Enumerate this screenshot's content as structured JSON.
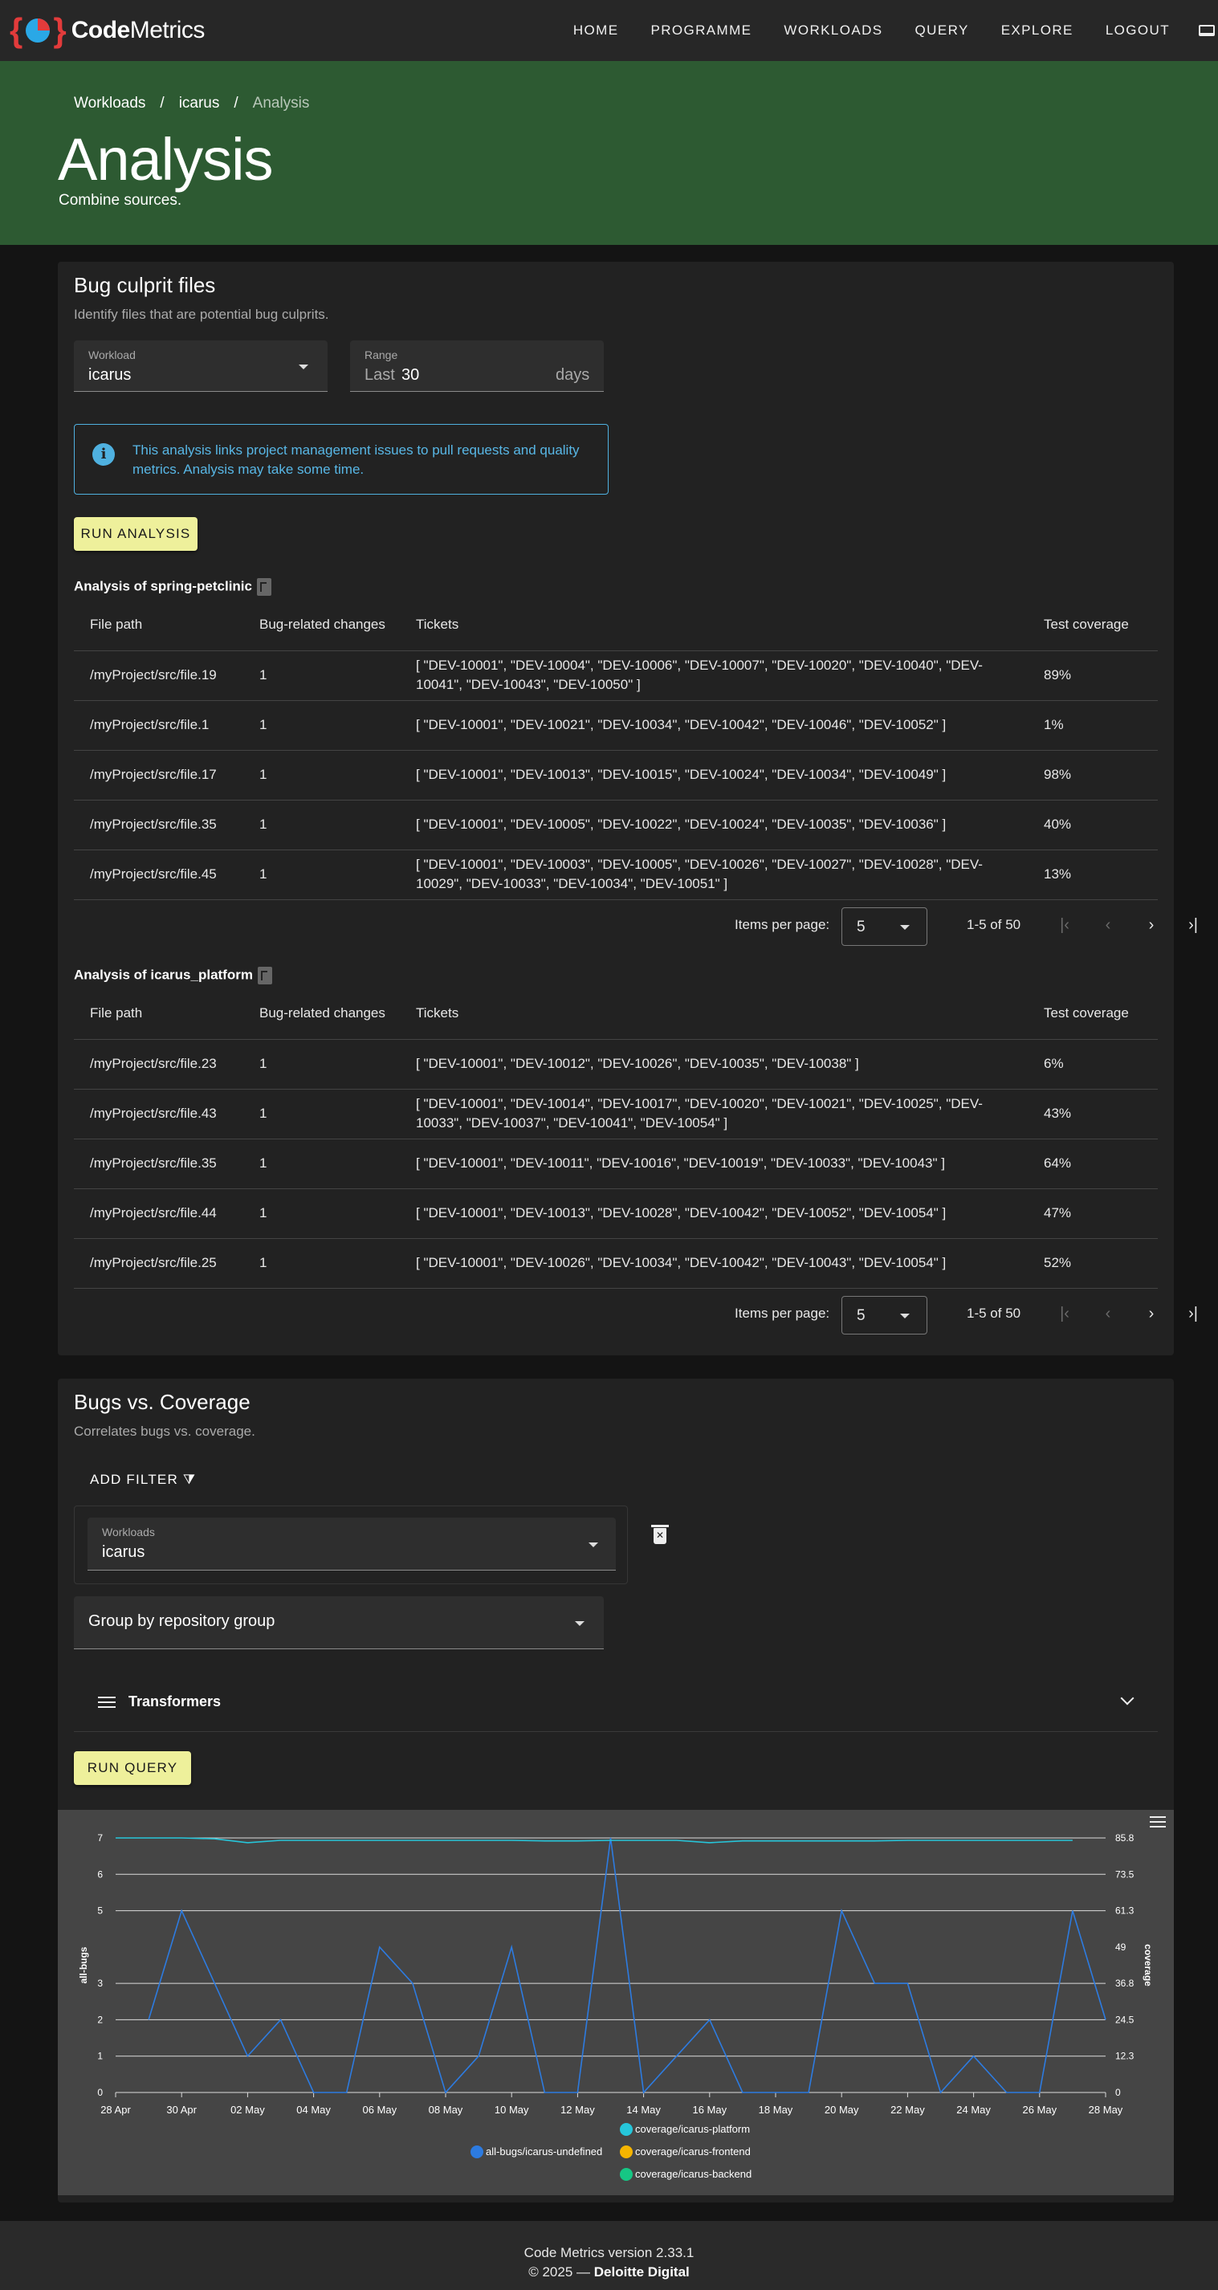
{
  "app": {
    "brand_prefix": "Code",
    "brand_suffix": "Metrics"
  },
  "nav": {
    "items": [
      "HOME",
      "PROGRAMME",
      "WORKLOADS",
      "QUERY",
      "EXPLORE",
      "LOGOUT"
    ]
  },
  "breadcrumb": {
    "items": [
      "Workloads",
      "icarus",
      "Analysis"
    ],
    "separator": "/"
  },
  "hero": {
    "title": "Analysis",
    "subtitle": "Combine sources."
  },
  "culprit": {
    "title": "Bug culprit files",
    "subtitle": "Identify files that are potential bug culprits.",
    "workload_label": "Workload",
    "workload_value": "icarus",
    "range_label": "Range",
    "range_prefix": "Last",
    "range_value": "30",
    "range_suffix": "days",
    "info": "This analysis links project management issues to pull requests and quality metrics. Analysis may take some time.",
    "run_button": "RUN ANALYSIS",
    "columns": [
      "File path",
      "Bug-related changes",
      "Tickets",
      "Test coverage"
    ],
    "tables": [
      {
        "title": "Analysis of spring-petclinic",
        "rows": [
          [
            "/myProject/src/file.19",
            "1",
            "[ \"DEV-10001\", \"DEV-10004\", \"DEV-10006\", \"DEV-10007\", \"DEV-10020\", \"DEV-10040\", \"DEV-10041\", \"DEV-10043\", \"DEV-10050\" ]",
            "89%"
          ],
          [
            "/myProject/src/file.1",
            "1",
            "[ \"DEV-10001\", \"DEV-10021\", \"DEV-10034\", \"DEV-10042\", \"DEV-10046\", \"DEV-10052\" ]",
            "1%"
          ],
          [
            "/myProject/src/file.17",
            "1",
            "[ \"DEV-10001\", \"DEV-10013\", \"DEV-10015\", \"DEV-10024\", \"DEV-10034\", \"DEV-10049\" ]",
            "98%"
          ],
          [
            "/myProject/src/file.35",
            "1",
            "[ \"DEV-10001\", \"DEV-10005\", \"DEV-10022\", \"DEV-10024\", \"DEV-10035\", \"DEV-10036\" ]",
            "40%"
          ],
          [
            "/myProject/src/file.45",
            "1",
            "[ \"DEV-10001\", \"DEV-10003\", \"DEV-10005\", \"DEV-10026\", \"DEV-10027\", \"DEV-10028\", \"DEV-10029\", \"DEV-10033\", \"DEV-10034\", \"DEV-10051\" ]",
            "13%"
          ]
        ],
        "items_per_page_label": "Items per page:",
        "items_per_page": "5",
        "range_text": "1-5 of 50"
      },
      {
        "title": "Analysis of icarus_platform",
        "rows": [
          [
            "/myProject/src/file.23",
            "1",
            "[ \"DEV-10001\", \"DEV-10012\", \"DEV-10026\", \"DEV-10035\", \"DEV-10038\" ]",
            "6%"
          ],
          [
            "/myProject/src/file.43",
            "1",
            "[ \"DEV-10001\", \"DEV-10014\", \"DEV-10017\", \"DEV-10020\", \"DEV-10021\", \"DEV-10025\", \"DEV-10033\", \"DEV-10037\", \"DEV-10041\", \"DEV-10054\" ]",
            "43%"
          ],
          [
            "/myProject/src/file.35",
            "1",
            "[ \"DEV-10001\", \"DEV-10011\", \"DEV-10016\", \"DEV-10019\", \"DEV-10033\", \"DEV-10043\" ]",
            "64%"
          ],
          [
            "/myProject/src/file.44",
            "1",
            "[ \"DEV-10001\", \"DEV-10013\", \"DEV-10028\", \"DEV-10042\", \"DEV-10052\", \"DEV-10054\" ]",
            "47%"
          ],
          [
            "/myProject/src/file.25",
            "1",
            "[ \"DEV-10001\", \"DEV-10026\", \"DEV-10034\", \"DEV-10042\", \"DEV-10043\", \"DEV-10054\" ]",
            "52%"
          ]
        ],
        "items_per_page_label": "Items per page:",
        "items_per_page": "5",
        "range_text": "1-5 of 50"
      }
    ]
  },
  "bugs_vs_coverage": {
    "title": "Bugs vs. Coverage",
    "subtitle": "Correlates bugs vs. coverage.",
    "add_filter": "ADD FILTER",
    "workloads_label": "Workloads",
    "workloads_value": "icarus",
    "group_by": "Group by repository group",
    "transformers": "Transformers",
    "run_button": "RUN QUERY"
  },
  "colors": {
    "accent_green": "#2d5a32",
    "button_yellow": "#eef09b",
    "info_blue": "#4fb1e0",
    "series_bugs": "#2d7be0",
    "series_platform": "#26c6da",
    "series_frontend": "#f5b400",
    "series_backend": "#16c784"
  },
  "chart_data": {
    "type": "line",
    "x": [
      "28 Apr",
      "29 Apr",
      "30 Apr",
      "01 May",
      "02 May",
      "03 May",
      "04 May",
      "05 May",
      "06 May",
      "07 May",
      "08 May",
      "09 May",
      "10 May",
      "11 May",
      "12 May",
      "13 May",
      "14 May",
      "15 May",
      "16 May",
      "17 May",
      "18 May",
      "19 May",
      "20 May",
      "21 May",
      "22 May",
      "23 May",
      "24 May",
      "25 May",
      "26 May",
      "27 May",
      "28 May"
    ],
    "x_tick_labels": [
      "28 Apr",
      "30 Apr",
      "02 May",
      "04 May",
      "06 May",
      "08 May",
      "10 May",
      "12 May",
      "14 May",
      "16 May",
      "18 May",
      "20 May",
      "22 May",
      "24 May",
      "26 May",
      "28 May"
    ],
    "ylabel": "all-bugs",
    "ylabel_right": "coverage",
    "y_ticks": [
      0,
      1,
      2,
      3,
      5,
      6,
      7
    ],
    "y_right_ticks": [
      0,
      12.3,
      24.5,
      36.8,
      49,
      61.3,
      73.5,
      85.8
    ],
    "ylim": [
      0,
      7
    ],
    "ylim_right": [
      0,
      85.8
    ],
    "grid": true,
    "legend_position": "bottom",
    "series": [
      {
        "name": "all-bugs/icarus-undefined",
        "axis": "left",
        "values": [
          null,
          2,
          5,
          3,
          1,
          2,
          0,
          0,
          4,
          3,
          0,
          1,
          4,
          0,
          0,
          7,
          0,
          1,
          2,
          0,
          0,
          0,
          5,
          3,
          3,
          0,
          1,
          0,
          0,
          5,
          2
        ]
      },
      {
        "name": "coverage/icarus-platform",
        "axis": "right",
        "values": [
          85.8,
          85.8,
          85.8,
          85.5,
          84.2,
          85,
          85,
          85,
          85,
          85,
          85,
          85,
          85,
          84.8,
          84.8,
          85,
          85,
          85,
          84.2,
          84.8,
          84.8,
          84.8,
          84.8,
          84.8,
          85,
          85,
          85,
          85,
          85,
          85,
          null
        ]
      },
      {
        "name": "coverage/icarus-frontend",
        "axis": "right",
        "values": []
      },
      {
        "name": "coverage/icarus-backend",
        "axis": "right",
        "values": []
      }
    ]
  },
  "footer": {
    "version": "Code Metrics version 2.33.1",
    "copyright": "© 2025 —",
    "company": "Deloitte Digital"
  }
}
